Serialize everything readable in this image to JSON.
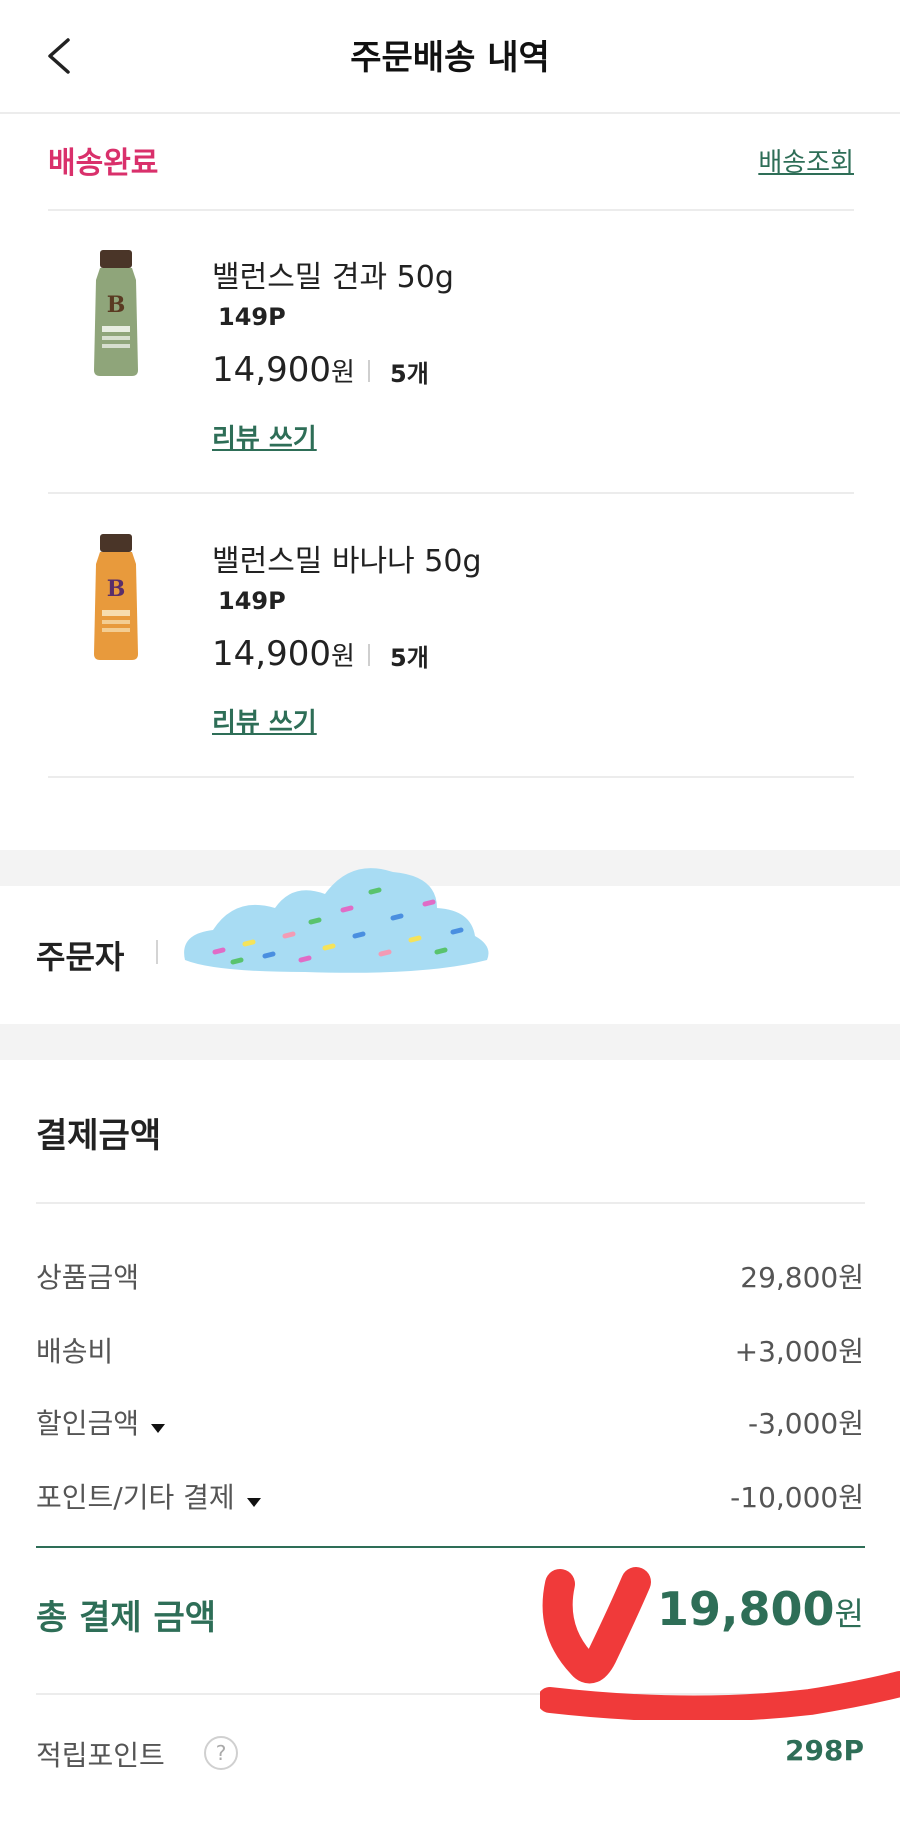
{
  "header": {
    "title": "주문배송 내역"
  },
  "order": {
    "status": "배송완료",
    "tracking_link": "배송조회",
    "items": [
      {
        "name": "밸런스밀 견과 50g",
        "points": "149P",
        "price": "14,900",
        "currency": "원",
        "quantity": "5개",
        "review_label": "리뷰 쓰기",
        "bottle_color": "#8fa57a"
      },
      {
        "name": "밸런스밀 바나나 50g",
        "points": "149P",
        "price": "14,900",
        "currency": "원",
        "quantity": "5개",
        "review_label": "리뷰 쓰기",
        "bottle_color": "#e89a3c"
      }
    ]
  },
  "orderer": {
    "label": "주문자"
  },
  "payment": {
    "title": "결제금액",
    "rows": [
      {
        "label": "상품금액",
        "value": "29,800원"
      },
      {
        "label": "배송비",
        "value": "+3,000원"
      },
      {
        "label": "할인금액",
        "value": "-3,000원"
      },
      {
        "label": "포인트/기타 결제",
        "value": "-10,000원"
      }
    ],
    "total_label": "총 결제 금액",
    "total_value": "19,800",
    "total_currency": "원",
    "points_label": "적립포인트",
    "points_help": "?",
    "points_value": "298P"
  },
  "colors": {
    "accent_green": "#2e6e57",
    "status_pink": "#d9306b",
    "annotation_red": "#f03a3a",
    "redaction_blue": "#a8dcf3"
  }
}
